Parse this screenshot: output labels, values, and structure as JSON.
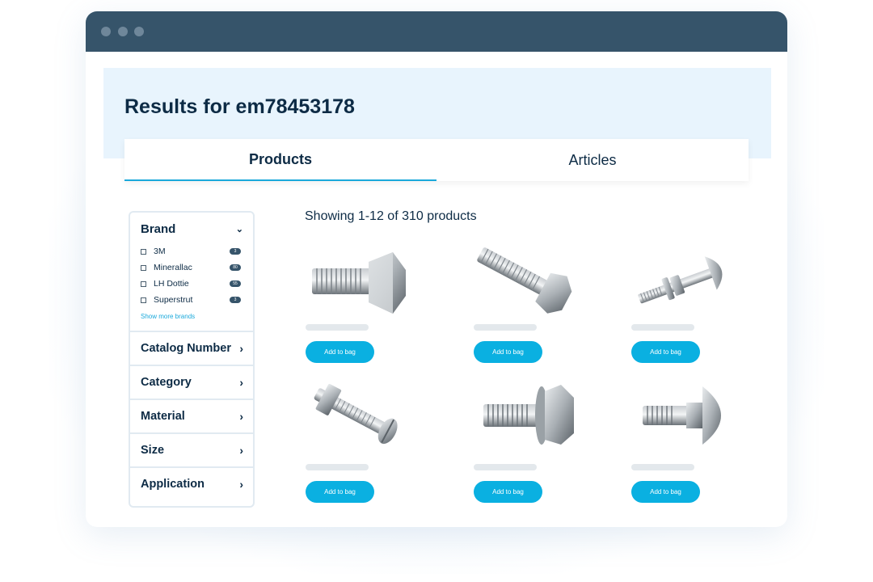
{
  "window": {
    "controls": [
      "close-dot",
      "minimize-dot",
      "maximize-dot"
    ]
  },
  "header": {
    "results_prefix": "Results for",
    "query": "em78453178"
  },
  "tabs": [
    {
      "label": "Products",
      "active": true
    },
    {
      "label": "Articles",
      "active": false
    }
  ],
  "filters": {
    "brand": {
      "title": "Brand",
      "items": [
        {
          "label": "3M",
          "count": "3"
        },
        {
          "label": "Minerallac",
          "count": "80"
        },
        {
          "label": "LH Dottie",
          "count": "55"
        },
        {
          "label": "Superstrut",
          "count": "3"
        }
      ],
      "show_more": "Show more brands"
    },
    "facets": [
      {
        "label": "Catalog Number"
      },
      {
        "label": "Category"
      },
      {
        "label": "Material"
      },
      {
        "label": "Size"
      },
      {
        "label": "Application"
      }
    ]
  },
  "results": {
    "summary": "Showing 1-12 of 310 products",
    "products": [
      {
        "image": "hex-bolt-short",
        "button": "Add to bag"
      },
      {
        "image": "hex-bolt-long",
        "button": "Add to bag"
      },
      {
        "image": "carriage-bolt-with-nut",
        "button": "Add to bag"
      },
      {
        "image": "slotted-bolt-with-square-nut",
        "button": "Add to bag"
      },
      {
        "image": "flange-hex-bolt",
        "button": "Add to bag"
      },
      {
        "image": "carriage-bolt",
        "button": "Add to bag"
      }
    ]
  },
  "colors": {
    "titlebar": "#36546a",
    "hero": "#e8f4fd",
    "accent": "#0ab0e1",
    "text": "#0d2b45"
  }
}
